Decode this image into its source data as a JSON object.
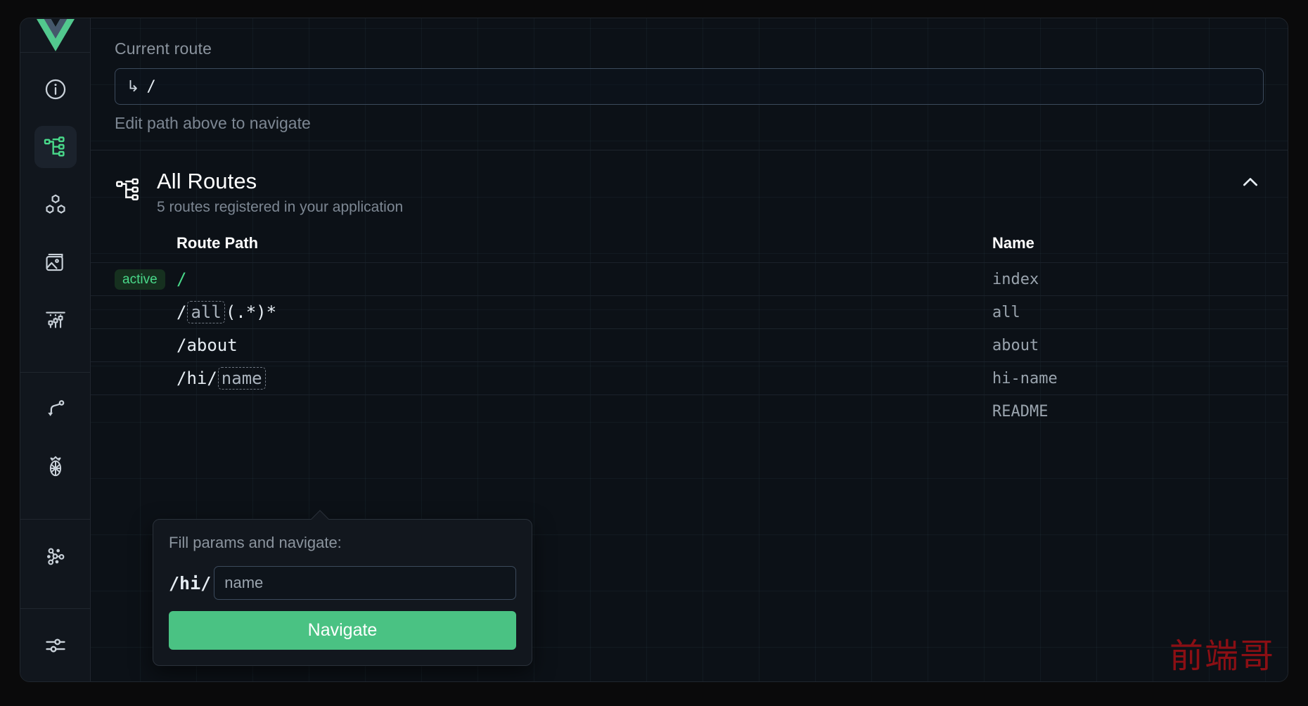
{
  "app": {
    "logo": "vue-logo"
  },
  "sidebar": {
    "items": [
      {
        "icon": "info-circle-icon",
        "name": "overview",
        "active": false
      },
      {
        "icon": "routes-tree-icon",
        "name": "routes",
        "active": true
      },
      {
        "icon": "components-icon",
        "name": "components",
        "active": false
      },
      {
        "icon": "assets-image-icon",
        "name": "assets",
        "active": false
      },
      {
        "icon": "timeline-icon",
        "name": "timeline",
        "active": false
      },
      {
        "icon": "router-path-icon",
        "name": "router",
        "active": false
      },
      {
        "icon": "pinia-icon",
        "name": "pinia",
        "active": false
      },
      {
        "icon": "graph-icon",
        "name": "graph",
        "active": false
      },
      {
        "icon": "settings-sliders-icon",
        "name": "settings",
        "active": false
      }
    ]
  },
  "current_route": {
    "label": "Current route",
    "arrow_glyph": "↳",
    "value": "/",
    "placeholder": "/",
    "hint": "Edit path above to navigate"
  },
  "all_routes": {
    "title": "All Routes",
    "subtitle": "5 routes registered in your application",
    "collapse_icon": "chevron-up-icon",
    "columns": {
      "badge": "",
      "path": "Route Path",
      "name": "Name"
    },
    "rows": [
      {
        "badge": "active",
        "path_parts": [
          {
            "t": "/",
            "param": false
          }
        ],
        "name": "index",
        "active": true
      },
      {
        "badge": "",
        "path_parts": [
          {
            "t": "/",
            "param": false
          },
          {
            "t": "all",
            "param": true
          },
          {
            "t": "(.*)*",
            "param": false
          }
        ],
        "name": "all",
        "active": false
      },
      {
        "badge": "",
        "path_parts": [
          {
            "t": "/about",
            "param": false
          }
        ],
        "name": "about",
        "active": false
      },
      {
        "badge": "",
        "path_parts": [
          {
            "t": "/hi/",
            "param": false
          },
          {
            "t": "name",
            "param": true
          }
        ],
        "name": "hi-name",
        "active": false
      },
      {
        "badge": "",
        "path_parts": [],
        "name": "README",
        "active": false
      }
    ]
  },
  "popover": {
    "title": "Fill params and navigate:",
    "prefix": "/hi/",
    "input_value": "",
    "input_placeholder": "name",
    "submit_label": "Navigate"
  },
  "watermark": {
    "text": "前端哥"
  },
  "colors": {
    "accent_green": "#4ac283",
    "badge_text": "#49d98a",
    "badge_bg": "#16301f",
    "panel_bg": "#0d1117",
    "sidebar_bg": "#11161d",
    "watermark": "#8b0f14"
  }
}
